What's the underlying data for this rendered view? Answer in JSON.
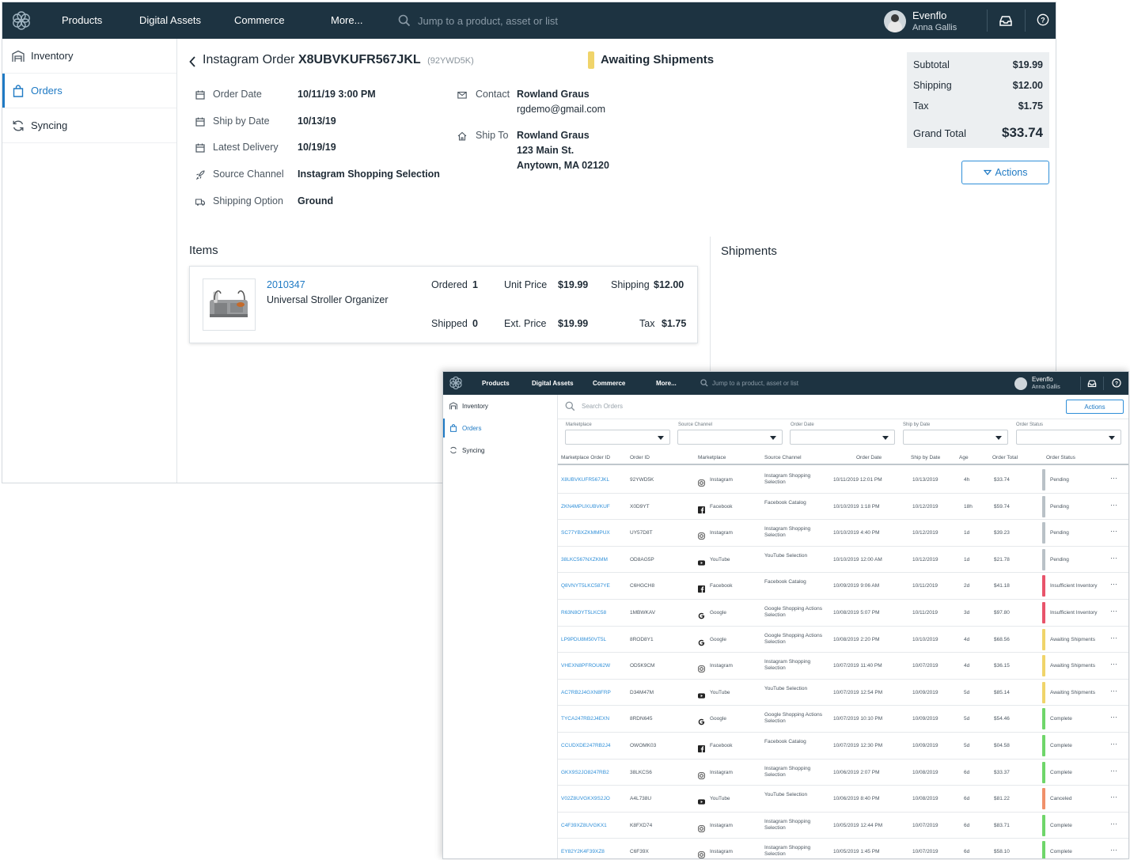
{
  "nav": {
    "items": [
      "Products",
      "Digital Assets",
      "Commerce",
      "More..."
    ],
    "search_placeholder": "Jump to a product, asset or list",
    "company": "Evenflo",
    "user": "Anna Gallis"
  },
  "sidebar": {
    "items": [
      {
        "label": "Inventory",
        "icon": "warehouse-icon"
      },
      {
        "label": "Orders",
        "icon": "shopping-bag-icon"
      },
      {
        "label": "Syncing",
        "icon": "sync-icon"
      }
    ]
  },
  "order": {
    "title_prefix": "Instagram Order",
    "id": "X8UBVKUFR567JKL",
    "sub_id": "(92YWD5K)",
    "status": "Awaiting Shipments",
    "fields": [
      {
        "label": "Order Date",
        "value": "10/11/19 3:00 PM",
        "icon": "calendar-icon"
      },
      {
        "label": "Ship by Date",
        "value": "10/13/19",
        "icon": "calendar-icon"
      },
      {
        "label": "Latest Delivery",
        "value": "10/19/19",
        "icon": "calendar-icon"
      },
      {
        "label": "Source Channel",
        "value": "Instagram Shopping Selection",
        "icon": "rocket-icon"
      },
      {
        "label": "Shipping Option",
        "value": "Ground",
        "icon": "truck-icon"
      }
    ],
    "contact": {
      "label": "Contact",
      "name": "Rowland Graus",
      "email": "rgdemo@gmail.com"
    },
    "ship_to": {
      "label": "Ship To",
      "name": "Rowland Graus",
      "line1": "123 Main St.",
      "line2": "Anytown, MA 02120"
    }
  },
  "totals": {
    "subtotal_label": "Subtotal",
    "subtotal": "$19.99",
    "shipping_label": "Shipping",
    "shipping": "$12.00",
    "tax_label": "Tax",
    "tax": "$1.75",
    "grand_label": "Grand Total",
    "grand": "$33.74"
  },
  "actions_label": "Actions",
  "items_title": "Items",
  "shipments_title": "Shipments",
  "item": {
    "sku": "2010347",
    "name": "Universal Stroller Organizer",
    "ordered_label": "Ordered",
    "ordered": "1",
    "shipped_label": "Shipped",
    "shipped": "0",
    "unit_price_label": "Unit Price",
    "unit_price": "$19.99",
    "ext_price_label": "Ext. Price",
    "ext_price": "$19.99",
    "shipping_label": "Shipping",
    "shipping": "$12.00",
    "tax_label": "Tax",
    "tax": "$1.75"
  },
  "orders_list": {
    "search_placeholder": "Search Orders",
    "actions_label": "Actions",
    "filters": [
      "Marketplace",
      "Source Channel",
      "Order Date",
      "Ship by Date",
      "Order Status"
    ],
    "columns": [
      "Marketplace Order ID",
      "Order ID",
      "Marketplace",
      "Source Channel",
      "Order Date",
      "Ship by Date",
      "Age",
      "Order Total",
      "Order Status"
    ],
    "status_colors": {
      "Pending": "#b9c1c7",
      "Insufficient Inventory": "#e8546b",
      "Awaiting Shipments": "#f0d46a",
      "Complete": "#6fd66a",
      "Canceled": "#f0906a"
    },
    "rows": [
      {
        "mid": "X8UBVKUFR567JKL",
        "oid": "92YWD5K",
        "mp": "Instagram",
        "mp_icon": "instagram-icon",
        "src": "Instagram Shopping Selection",
        "date": "10/11/2019 12:01 PM",
        "ship": "10/13/2019",
        "age": "4h",
        "total": "$33.74",
        "status": "Pending"
      },
      {
        "mid": "ZKN4MPUXUBVKUF",
        "oid": "X0D9YT",
        "mp": "Facebook",
        "mp_icon": "facebook-icon",
        "src": "Facebook Catalog",
        "date": "10/10/2019 1:18 PM",
        "ship": "10/12/2019",
        "age": "18h",
        "total": "$59.74",
        "status": "Pending"
      },
      {
        "mid": "SC77YBXZKMMPUX",
        "oid": "UY57D8T",
        "mp": "Instagram",
        "mp_icon": "instagram-icon",
        "src": "Instagram Shopping Selection",
        "date": "10/10/2019 4:40 PM",
        "ship": "10/12/2019",
        "age": "1d",
        "total": "$39.23",
        "status": "Pending"
      },
      {
        "mid": "38LKC567NXZKMM",
        "oid": "OD8AG5P",
        "mp": "YouTube",
        "mp_icon": "youtube-icon",
        "src": "YouTube Selection",
        "date": "10/10/2019 12:00 AM",
        "ship": "10/12/2019",
        "age": "1d",
        "total": "$21.78",
        "status": "Pending"
      },
      {
        "mid": "Q8VNYT5LKC587YE",
        "oid": "C6HGCH8",
        "mp": "Facebook",
        "mp_icon": "facebook-icon",
        "src": "Facebook Catalog",
        "date": "10/09/2019 9:06 AM",
        "ship": "10/11/2019",
        "age": "2d",
        "total": "$41.18",
        "status": "Insufficient Inventory"
      },
      {
        "mid": "R63N8OYT5LKC58",
        "oid": "1MBWKAV",
        "mp": "Google",
        "mp_icon": "google-icon",
        "src": "Google Shopping Actions Selection",
        "date": "10/08/2019 5:07 PM",
        "ship": "10/11/2019",
        "age": "3d",
        "total": "$97.80",
        "status": "Insufficient Inventory"
      },
      {
        "mid": "LP9PDU8M50VT5L",
        "oid": "8ROD8Y1",
        "mp": "Google",
        "mp_icon": "google-icon",
        "src": "Google Shopping Actions Selection",
        "date": "10/08/2019 2:20 PM",
        "ship": "10/10/2019",
        "age": "4d",
        "total": "$68.56",
        "status": "Awaiting Shipments"
      },
      {
        "mid": "VHEXN8PFROU62W",
        "oid": "OD5K9CM",
        "mp": "Instagram",
        "mp_icon": "instagram-icon",
        "src": "Instagram Shopping Selection",
        "date": "10/07/2019 11:40 PM",
        "ship": "10/07/2019",
        "age": "4d",
        "total": "$36.15",
        "status": "Awaiting Shipments"
      },
      {
        "mid": "AC7RB2J4GXN8FRP",
        "oid": "D34M47M",
        "mp": "YouTube",
        "mp_icon": "youtube-icon",
        "src": "YouTube Selection",
        "date": "10/07/2019 12:54 PM",
        "ship": "10/09/2019",
        "age": "5d",
        "total": "$85.14",
        "status": "Awaiting Shipments"
      },
      {
        "mid": "TYCA247RB2J4EXN",
        "oid": "8RDN645",
        "mp": "Google",
        "mp_icon": "google-icon",
        "src": "Google Shopping Actions Selection",
        "date": "10/07/2019 10:10 PM",
        "ship": "10/09/2019",
        "age": "5d",
        "total": "$54.46",
        "status": "Complete"
      },
      {
        "mid": "CCUDXDE247RB2J4",
        "oid": "OWOMK03",
        "mp": "Facebook",
        "mp_icon": "facebook-icon",
        "src": "Facebook Catalog",
        "date": "10/07/2019 12:30 PM",
        "ship": "10/09/2019",
        "age": "5d",
        "total": "$04.58",
        "status": "Complete"
      },
      {
        "mid": "GKX9S2JO8247RB2",
        "oid": "38LKCS6",
        "mp": "Instagram",
        "mp_icon": "instagram-icon",
        "src": "Instagram Shopping Selection",
        "date": "10/06/2019 2:07 PM",
        "ship": "10/08/2019",
        "age": "6d",
        "total": "$33.37",
        "status": "Complete"
      },
      {
        "mid": "V02Z8UVGKX9S2JO",
        "oid": "A4L738U",
        "mp": "YouTube",
        "mp_icon": "youtube-icon",
        "src": "YouTube Selection",
        "date": "10/06/2019 8:40 PM",
        "ship": "10/08/2019",
        "age": "6d",
        "total": "$81.22",
        "status": "Canceled"
      },
      {
        "mid": "C4F39XZ8UVGKX1",
        "oid": "K8FXD74",
        "mp": "Instagram",
        "mp_icon": "instagram-icon",
        "src": "Instagram Shopping Selection",
        "date": "10/05/2019 12:44 PM",
        "ship": "10/07/2019",
        "age": "6d",
        "total": "$83.71",
        "status": "Complete"
      },
      {
        "mid": "EY82Y2K4F39XZ8",
        "oid": "C6F39X",
        "mp": "Instagram",
        "mp_icon": "instagram-icon",
        "src": "Instagram Shopping Selection",
        "date": "10/05/2019 1:45 PM",
        "ship": "10/07/2019",
        "age": "6d",
        "total": "$58.10",
        "status": "Complete"
      }
    ]
  }
}
